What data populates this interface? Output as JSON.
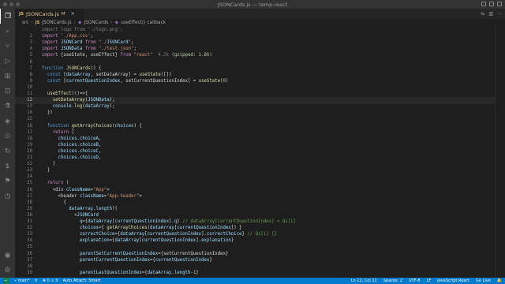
{
  "window": {
    "title": "JSONCards.js — temp-react"
  },
  "activity_bar": {
    "items": [
      {
        "name": "explorer-icon",
        "glyph": "❐"
      },
      {
        "name": "search-icon",
        "glyph": "⌕"
      },
      {
        "name": "source-control-icon",
        "glyph": "⑂"
      },
      {
        "name": "run-debug-icon",
        "glyph": "▷"
      },
      {
        "name": "extensions-icon",
        "glyph": "⊞"
      },
      {
        "name": "remote-explorer-icon",
        "glyph": "⊡"
      },
      {
        "name": "testing-icon",
        "glyph": "⚗"
      },
      {
        "name": "docker-icon",
        "glyph": "◈"
      },
      {
        "name": "git-graph-icon",
        "glyph": "⊙"
      },
      {
        "name": "live-share-icon",
        "glyph": "↻"
      },
      {
        "name": "dollar-icon",
        "glyph": "$"
      },
      {
        "name": "bookmarks-icon",
        "glyph": "⚑"
      },
      {
        "name": "timeline-icon",
        "glyph": "◷"
      },
      {
        "name": "account-icon",
        "glyph": "◉"
      },
      {
        "name": "settings-gear-icon",
        "glyph": "⚙"
      }
    ]
  },
  "tab": {
    "lang": "JS",
    "filename": "JSONCards.js",
    "status": "M",
    "close": "×"
  },
  "breadcrumb": {
    "folder": "src",
    "lang": "JS",
    "file": "JSONCards.js",
    "symbol1": "JSONCards",
    "symbol2": "useEffect() callback"
  },
  "editor": {
    "lines": [
      {
        "n": "",
        "t": "import logo from './logo.png';"
      },
      {
        "n": "2",
        "t": "import './App.css';"
      },
      {
        "n": "3",
        "t": "import JSONCard from \"./JSONCard\";"
      },
      {
        "n": "4",
        "t": "import JSONData from \"./test.json\";"
      },
      {
        "n": "5",
        "t": "import {useState, useEffect} from \"react\"  4.2k (gzipped: 1.8k)"
      },
      {
        "n": "6",
        "t": ""
      },
      {
        "n": "7",
        "t": "function JSONCards() {"
      },
      {
        "n": "8",
        "t": "  const [dataArray, setDataArray] = useState([])"
      },
      {
        "n": "9",
        "t": "  const [currentQuestionIndex, setCurrentQuestionIndex] = useState(0)"
      },
      {
        "n": "10",
        "t": ""
      },
      {
        "n": "11",
        "t": "  useEffect(()=>{"
      },
      {
        "n": "12",
        "t": "    setDataArray(JSONData);"
      },
      {
        "n": "13",
        "t": "    console.log(dataArray);"
      },
      {
        "n": "14",
        "t": "  })"
      },
      {
        "n": "15",
        "t": ""
      },
      {
        "n": "16",
        "t": "  function getArrayChoices(choices) {"
      },
      {
        "n": "17",
        "t": "    return ["
      },
      {
        "n": "18",
        "t": "      choices.choiceA,"
      },
      {
        "n": "19",
        "t": "      choices.choiceB,"
      },
      {
        "n": "20",
        "t": "      choices.choiceC,"
      },
      {
        "n": "21",
        "t": "      choices.choiceD,"
      },
      {
        "n": "22",
        "t": "    ]"
      },
      {
        "n": "23",
        "t": "  }"
      },
      {
        "n": "24",
        "t": ""
      },
      {
        "n": "25",
        "t": "  return ("
      },
      {
        "n": "26",
        "t": "    <div className=\"App\">"
      },
      {
        "n": "27",
        "t": "      <header className=\"App-header\">"
      },
      {
        "n": "28",
        "t": "        {"
      },
      {
        "n": "29",
        "t": "          dataArray.length?("
      },
      {
        "n": "30",
        "t": "            <JSONCard"
      },
      {
        "n": "31",
        "t": "              q={dataArray[currentQuestionIndex].q} // dataArray[currentQuestionIndex] = Qs[i]"
      },
      {
        "n": "32",
        "t": "              choices={ getArrayChoices(dataArray[currentQuestionIndex]) }"
      },
      {
        "n": "33",
        "t": "              correctChoice={dataArray[currentQuestionIndex].correctChoice} // Qs[i] {}"
      },
      {
        "n": "34",
        "t": "              explanation={dataArray[currentQuestionIndex].explanation}"
      },
      {
        "n": "35",
        "t": ""
      },
      {
        "n": "36",
        "t": "              parentSetCurrentQuestionIndex={setCurrentQuestionIndex}"
      },
      {
        "n": "37",
        "t": "              parentCurrentQuestionIndex={currentQuestionIndex}"
      },
      {
        "n": "38",
        "t": ""
      },
      {
        "n": "39",
        "t": "              parentLastQuestionIndex={dataArray.length-1}"
      }
    ]
  },
  "status_bar": {
    "branch": "main*",
    "sync": "⟳",
    "errors": "⊗ 0 ⚠ 0",
    "auto_attach": "Auto Attach: Smart",
    "position": "Ln 12, Col 11",
    "spaces": "Spaces: 2",
    "encoding": "UTF-8",
    "eol": "LF",
    "language": "JavaScript React",
    "go_live": "Go Live"
  },
  "colors": {
    "status_bar": "#007acc",
    "editor_bg": "#1e1e1e",
    "activity_bar": "#333333"
  }
}
